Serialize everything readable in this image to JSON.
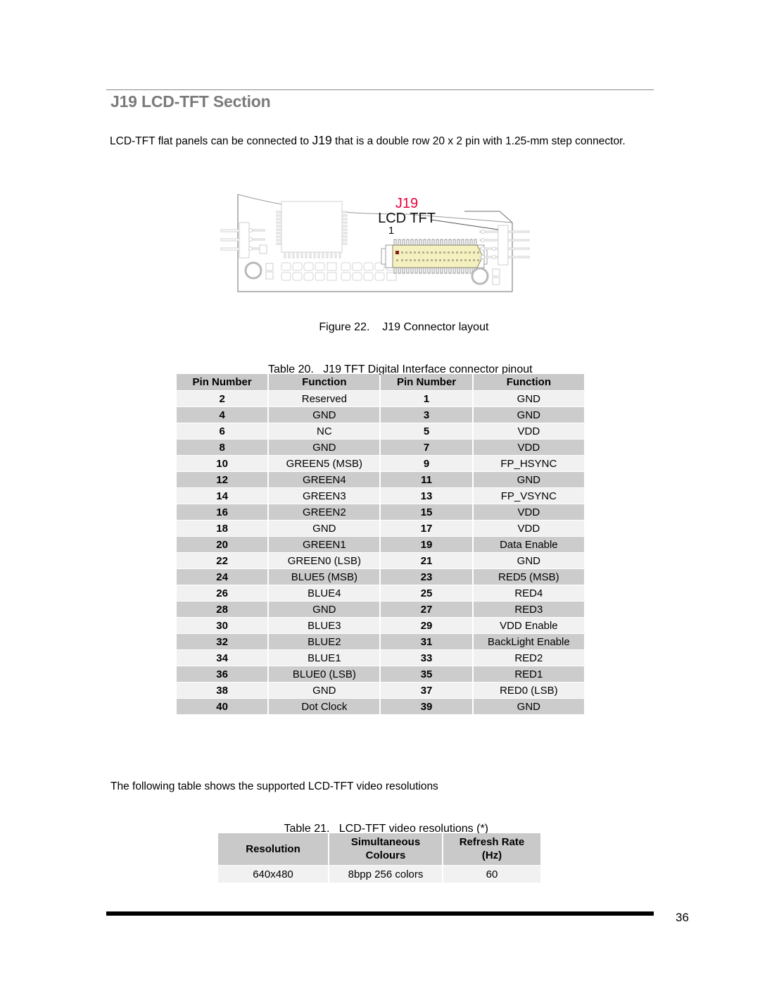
{
  "document": {
    "section_heading": "J19 LCD-TFT Section",
    "intro_paragraph_part1": "LCD-TFT flat panels can be connected to ",
    "intro_paragraph_emphasis": "J19",
    "intro_paragraph_part2": " that is a double row 20 x 2 pin with 1.25-mm step connector.",
    "page_number": "36"
  },
  "figure": {
    "caption_label": "Figure 22.",
    "caption_text": "J19 Connector layout",
    "connector_label_top": "J19",
    "connector_label_bottom": "LCD TFT",
    "pin_one_marker": "1",
    "colors": {
      "connector_label_accent": "#e8003c",
      "connector_body": "#f5f0c0",
      "connector_outline": "#8a8560",
      "pin_one_pad": "#8b1a1a",
      "board_outline": "#4a4a4a",
      "board_detail": "#d8d8d8"
    }
  },
  "table20": {
    "caption_label": "Table 20.",
    "caption_text": "J19 TFT Digital Interface connector pinout",
    "headers": [
      "Pin Number",
      "Function",
      "Pin Number",
      "Function"
    ],
    "rows": [
      [
        "2",
        "Reserved",
        "1",
        "GND"
      ],
      [
        "4",
        "GND",
        "3",
        "GND"
      ],
      [
        "6",
        "NC",
        "5",
        "VDD"
      ],
      [
        "8",
        "GND",
        "7",
        "VDD"
      ],
      [
        "10",
        "GREEN5 (MSB)",
        "9",
        "FP_HSYNC"
      ],
      [
        "12",
        "GREEN4",
        "11",
        "GND"
      ],
      [
        "14",
        "GREEN3",
        "13",
        "FP_VSYNC"
      ],
      [
        "16",
        "GREEN2",
        "15",
        "VDD"
      ],
      [
        "18",
        "GND",
        "17",
        "VDD"
      ],
      [
        "20",
        "GREEN1",
        "19",
        "Data Enable"
      ],
      [
        "22",
        "GREEN0 (LSB)",
        "21",
        "GND"
      ],
      [
        "24",
        "BLUE5 (MSB)",
        "23",
        "RED5 (MSB)"
      ],
      [
        "26",
        "BLUE4",
        "25",
        "RED4"
      ],
      [
        "28",
        "GND",
        "27",
        "RED3"
      ],
      [
        "30",
        "BLUE3",
        "29",
        "VDD Enable"
      ],
      [
        "32",
        "BLUE2",
        "31",
        "BackLight Enable"
      ],
      [
        "34",
        "BLUE1",
        "33",
        "RED2"
      ],
      [
        "36",
        "BLUE0 (LSB)",
        "35",
        "RED1"
      ],
      [
        "38",
        "GND",
        "37",
        "RED0 (LSB)"
      ],
      [
        "40",
        "Dot Clock",
        "39",
        "GND"
      ]
    ]
  },
  "bottom": {
    "paragraph": "The following table shows the supported LCD-TFT video resolutions"
  },
  "table21": {
    "caption_label": "Table 21.",
    "caption_text": "LCD-TFT video resolutions (*)",
    "headers": [
      "Resolution",
      "Simultaneous\nColours",
      "Refresh Rate\n(Hz)"
    ],
    "header_lines": [
      [
        "Resolution",
        ""
      ],
      [
        "Simultaneous",
        "Colours"
      ],
      [
        "Refresh Rate",
        "(Hz)"
      ]
    ],
    "rows": [
      [
        "640x480",
        "8bpp 256 colors",
        "60"
      ]
    ]
  },
  "theme": {
    "header_bg": "#c9c9c9",
    "row_light": "#f1f1f1",
    "row_dark": "#cccccc",
    "heading_gray": "#7a7a7a"
  }
}
